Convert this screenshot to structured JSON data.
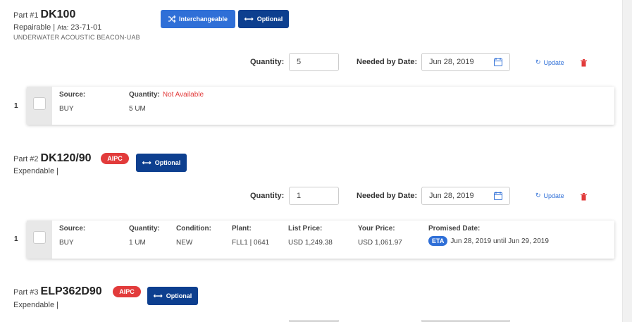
{
  "parts": [
    {
      "prefix": "Part #1",
      "number": "DK100",
      "type_line": "Repairable |",
      "ata_label": "Ata:",
      "ata_value": "23-71-01",
      "description": "UNDERWATER ACOUSTIC BEACON-UAB",
      "buttons": {
        "interchangeable": "Interchangeable",
        "optional": "Optional"
      },
      "quantity_label": "Quantity:",
      "quantity_value": "5",
      "needed_label": "Needed by Date:",
      "needed_value": "Jun 28, 2019",
      "update_label": "Update",
      "row_index": "1",
      "source": {
        "header": "Source:",
        "value": "BUY"
      },
      "qty": {
        "header": "Quantity:",
        "status": "Not Available",
        "value": "5 UM"
      }
    },
    {
      "prefix": "Part #2",
      "number": "DK120/90",
      "badge": "AIPC",
      "type_line": "Expendable |",
      "buttons": {
        "optional": "Optional"
      },
      "quantity_label": "Quantity:",
      "quantity_value": "1",
      "needed_label": "Needed by Date:",
      "needed_value": "Jun 28, 2019",
      "update_label": "Update",
      "row_index": "1",
      "columns": {
        "source": {
          "header": "Source:",
          "value": "BUY"
        },
        "quantity": {
          "header": "Quantity:",
          "value": "1 UM"
        },
        "condition": {
          "header": "Condition:",
          "value": "NEW"
        },
        "plant": {
          "header": "Plant:",
          "value": "FLL1 | 0641"
        },
        "list_price": {
          "header": "List Price:",
          "value": "USD 1,249.38"
        },
        "your_price": {
          "header": "Your Price:",
          "value": "USD 1,061.97"
        },
        "promised": {
          "header": "Promised Date:",
          "eta": "ETA",
          "value": "Jun 28, 2019 until Jun 29, 2019"
        }
      }
    },
    {
      "prefix": "Part #3",
      "number": "ELP362D90",
      "badge": "AIPC",
      "type_line": "Expendable |",
      "buttons": {
        "optional": "Optional"
      }
    }
  ],
  "icons": {
    "shuffle": "shuffle-icon",
    "arrows": "left-right-arrow-icon",
    "calendar": "calendar-icon",
    "refresh": "refresh-icon",
    "trash": "trash-icon"
  },
  "colors": {
    "primary": "#2f6fd7",
    "navy": "#0d3f8f",
    "danger": "#e23b3b"
  }
}
